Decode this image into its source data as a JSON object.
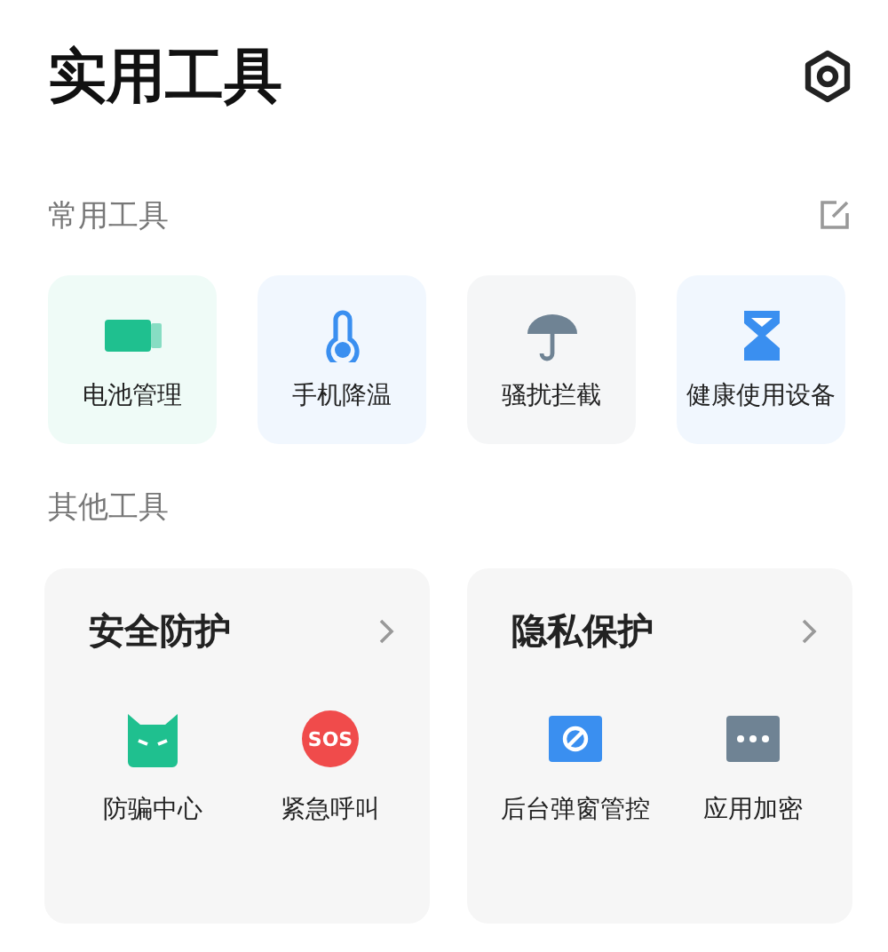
{
  "header": {
    "title": "实用工具"
  },
  "common": {
    "title": "常用工具",
    "tools": [
      {
        "label": "电池管理",
        "kind": "battery",
        "color": "#1fc08f"
      },
      {
        "label": "手机降温",
        "kind": "thermometer",
        "color": "#3a8ff0"
      },
      {
        "label": "骚扰拦截",
        "kind": "umbrella",
        "color": "#6f8394"
      },
      {
        "label": "健康使用设备",
        "kind": "hourglass",
        "color": "#3a8ff0"
      }
    ]
  },
  "other": {
    "title": "其他工具",
    "groups": [
      {
        "title": "安全防护",
        "items": [
          {
            "label": "防骗中心",
            "kind": "guard",
            "color": "#1fc08f"
          },
          {
            "label": "紧急呼叫",
            "kind": "sos",
            "color": "#f04b4b",
            "badge": "SOS"
          }
        ]
      },
      {
        "title": "隐私保护",
        "items": [
          {
            "label": "后台弹窗管控",
            "kind": "block",
            "color": "#3a8ff0"
          },
          {
            "label": "应用加密",
            "kind": "lock",
            "color": "#6f8394"
          }
        ]
      }
    ]
  }
}
